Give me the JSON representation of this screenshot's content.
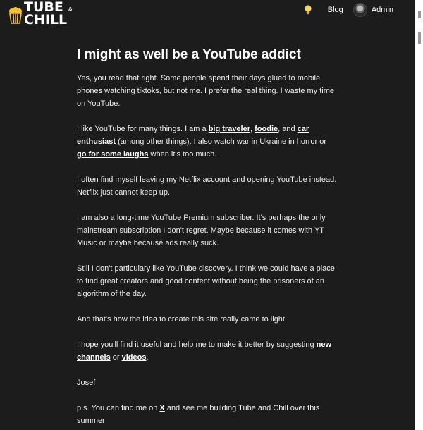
{
  "header": {
    "logo_line1": "TUBE",
    "logo_amp": "&",
    "logo_line2": "CHILL",
    "theme_icon": "lightbulb-icon",
    "blog_label": "Blog",
    "admin_label": "Admin"
  },
  "article": {
    "title": "I might as well be a YouTube addict",
    "p1": "Yes, you read that right. Some people spend their days glued to mobile phones watching tiktoks, but not me. I prefer the real thing. I waste my time on YouTube.",
    "p2": {
      "t1": "I like YouTube for many things. I am a ",
      "l1": "big traveler",
      "t2": ", ",
      "l2": "foodie",
      "t3": ", and ",
      "l3": "car enthusiast",
      "t4": " (among other things). I also watch war in Ukraine in horror or ",
      "l4": "go for some laughs",
      "t5": " when it's too much."
    },
    "p3": "I often find myself leaving my Netflix account and opening YouTube instead. Netflix just cannot keep up.",
    "p4": "I am also a long-time YouTube Premium subscriber. It's perhaps the only mainstream subscription I don't regret. Maybe because it comes with YT Music or maybe because ads really suck.",
    "p5": "Still I don't particulary like YouTube discovery. I think we could have a place to find great creators and good content without being the prisoners of an algorithm of the day.",
    "p6": "And that's how the idea to create this site really came to light.",
    "p7": {
      "t1": "I hope you'll find it useful and help me to make it better by suggesting ",
      "l1": "new channels",
      "t2": " or ",
      "l2": "videos",
      "t3": "."
    },
    "signature": "Josef",
    "ps": {
      "t1": "p.s. You can find me on ",
      "l1": "X",
      "t2": " and see me building Tube and Chill over this summer"
    }
  },
  "colors": {
    "background": "#1c1c1c",
    "text": "#ededed",
    "logo_accent": "#f2c230"
  }
}
